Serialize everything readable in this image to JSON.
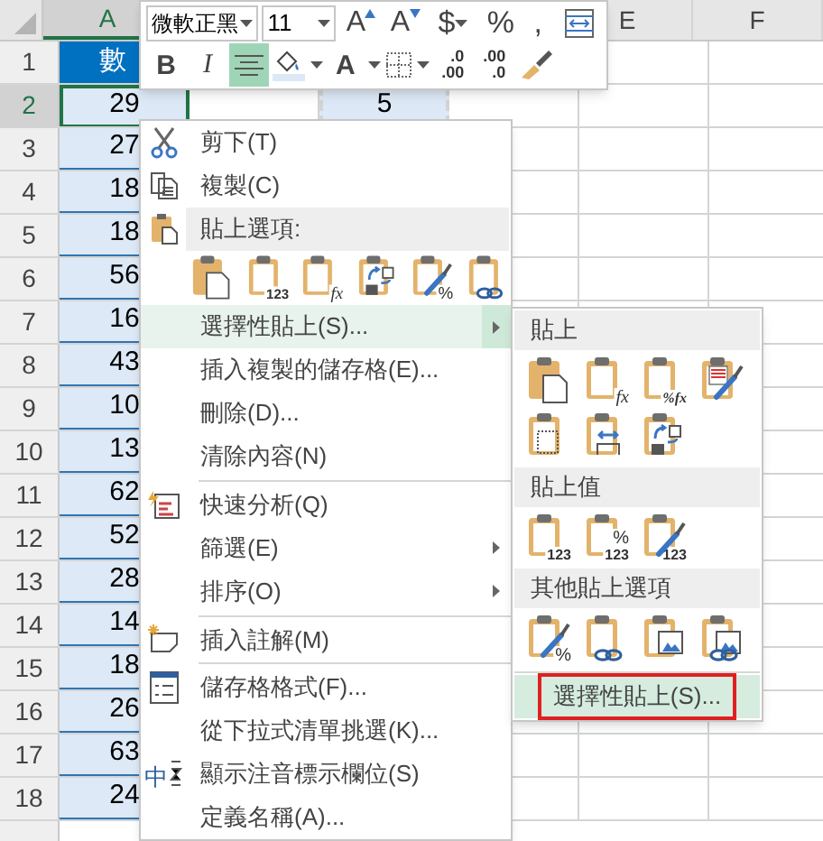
{
  "sheet": {
    "columns": [
      {
        "label": "A",
        "selected": true
      },
      {
        "label": "E",
        "selected": false
      },
      {
        "label": "F",
        "selected": false
      }
    ],
    "rows": [
      {
        "label": "1",
        "selected": false,
        "kind": "header",
        "a": "數"
      },
      {
        "label": "2",
        "selected": true,
        "kind": "data",
        "a": "29",
        "c": "5"
      },
      {
        "label": "3",
        "selected": false,
        "kind": "data",
        "a": "27"
      },
      {
        "label": "4",
        "selected": false,
        "kind": "data",
        "a": "18"
      },
      {
        "label": "5",
        "selected": false,
        "kind": "data",
        "a": "18"
      },
      {
        "label": "6",
        "selected": false,
        "kind": "data",
        "a": "56"
      },
      {
        "label": "7",
        "selected": false,
        "kind": "data",
        "a": "16"
      },
      {
        "label": "8",
        "selected": false,
        "kind": "data",
        "a": "43"
      },
      {
        "label": "9",
        "selected": false,
        "kind": "data",
        "a": "10"
      },
      {
        "label": "10",
        "selected": false,
        "kind": "data",
        "a": "13"
      },
      {
        "label": "11",
        "selected": false,
        "kind": "data",
        "a": "62"
      },
      {
        "label": "12",
        "selected": false,
        "kind": "data",
        "a": "52"
      },
      {
        "label": "13",
        "selected": false,
        "kind": "data",
        "a": "28"
      },
      {
        "label": "14",
        "selected": false,
        "kind": "data",
        "a": "14"
      },
      {
        "label": "15",
        "selected": false,
        "kind": "data",
        "a": "18"
      },
      {
        "label": "16",
        "selected": false,
        "kind": "data",
        "a": "26"
      },
      {
        "label": "17",
        "selected": false,
        "kind": "data",
        "a": "63"
      },
      {
        "label": "18",
        "selected": false,
        "kind": "data",
        "a": "24"
      }
    ]
  },
  "mini_toolbar": {
    "font": "微軟正黑",
    "size": "11",
    "row_1": [
      {
        "kind": "grow-font",
        "glyph": "A",
        "dropdown": false
      },
      {
        "kind": "shrink-font",
        "glyph": "A",
        "dropdown": false
      },
      {
        "kind": "currency",
        "glyph": "$",
        "dropdown": true
      },
      {
        "kind": "percent",
        "glyph": "%",
        "dropdown": false
      },
      {
        "kind": "comma",
        "glyph": ",",
        "dropdown": false
      },
      {
        "kind": "format-table",
        "dropdown": false
      }
    ],
    "row_2": [
      {
        "kind": "bold",
        "glyph": "B",
        "selected": false,
        "dropdown": false
      },
      {
        "kind": "italic",
        "glyph": "I",
        "selected": false,
        "dropdown": false
      },
      {
        "kind": "align-center",
        "selected": true,
        "dropdown": false
      },
      {
        "kind": "fill-color",
        "selected": false,
        "dropdown": true
      },
      {
        "kind": "font-color",
        "glyph": "A",
        "selected": false,
        "dropdown": true
      },
      {
        "kind": "borders",
        "selected": false,
        "dropdown": true
      },
      {
        "kind": "decimal-increase",
        "lines": [
          ".0",
          ".00"
        ],
        "selected": false,
        "dropdown": false
      },
      {
        "kind": "decimal-decrease",
        "lines": [
          ".00",
          ".0"
        ],
        "selected": false,
        "dropdown": false
      },
      {
        "kind": "format-painter",
        "selected": false,
        "dropdown": false
      }
    ]
  },
  "context_menu": {
    "items": [
      {
        "kind": "item",
        "label": "剪下(T)",
        "selected": false,
        "submenu": false
      },
      {
        "kind": "item",
        "label": "複製(C)",
        "selected": false,
        "submenu": false
      },
      {
        "kind": "heading",
        "label": "貼上選項:"
      },
      {
        "kind": "paste-icons",
        "icons": [
          {
            "kind": "page"
          },
          {
            "kind": "glyph",
            "glyphs": [
              "123"
            ]
          },
          {
            "kind": "glyph",
            "glyphs": [
              "fx"
            ]
          },
          {
            "kind": "transpose"
          },
          {
            "kind": "glyph",
            "glyphs": [
              "%"
            ],
            "brush": true
          },
          {
            "kind": "link"
          }
        ]
      },
      {
        "kind": "item",
        "label": "選擇性貼上(S)...",
        "selected": true,
        "submenu": true
      },
      {
        "kind": "item",
        "label": "插入複製的儲存格(E)...",
        "selected": false,
        "submenu": false
      },
      {
        "kind": "item",
        "label": "刪除(D)...",
        "selected": false,
        "submenu": false
      },
      {
        "kind": "item",
        "label": "清除內容(N)",
        "selected": false,
        "submenu": false
      },
      {
        "kind": "separator"
      },
      {
        "kind": "item",
        "label": "快速分析(Q)",
        "selected": false,
        "submenu": false
      },
      {
        "kind": "item",
        "label": "篩選(E)",
        "selected": false,
        "submenu": true
      },
      {
        "kind": "item",
        "label": "排序(O)",
        "selected": false,
        "submenu": true
      },
      {
        "kind": "separator"
      },
      {
        "kind": "item",
        "label": "插入註解(M)",
        "selected": false,
        "submenu": false
      },
      {
        "kind": "separator"
      },
      {
        "kind": "item",
        "label": "儲存格格式(F)...",
        "selected": false,
        "submenu": false
      },
      {
        "kind": "item",
        "label": "從下拉式清單挑選(K)...",
        "selected": false,
        "submenu": false
      },
      {
        "kind": "item",
        "label": "顯示注音標示欄位(S)",
        "icon_glyph": "中",
        "selected": false,
        "submenu": false
      },
      {
        "kind": "item",
        "label": "定義名稱(A)...",
        "selected": false,
        "submenu": false
      }
    ]
  },
  "paste_submenu": {
    "sections": [
      {
        "title": "貼上",
        "icons": [
          {
            "kind": "page"
          },
          {
            "kind": "glyph",
            "glyphs": [
              "fx"
            ]
          },
          {
            "kind": "glyph",
            "glyphs": [
              "%fx"
            ]
          },
          {
            "kind": "page-lines",
            "brush": true
          },
          {
            "kind": "grid"
          },
          {
            "kind": "width"
          },
          {
            "kind": "transpose"
          }
        ]
      },
      {
        "title": "貼上值",
        "icons": [
          {
            "kind": "glyph",
            "glyphs": [
              "123"
            ]
          },
          {
            "kind": "glyph",
            "glyphs": [
              "%",
              "123"
            ]
          },
          {
            "kind": "glyph",
            "glyphs": [
              "123"
            ],
            "brush": true
          }
        ]
      },
      {
        "title": "其他貼上選項",
        "icons": [
          {
            "kind": "glyph",
            "glyphs": [
              "%"
            ],
            "brush": true
          },
          {
            "kind": "link"
          },
          {
            "kind": "picture"
          },
          {
            "kind": "linked-picture"
          }
        ]
      }
    ],
    "footer": {
      "label": "選擇性貼上(S)...",
      "selected": true,
      "outlined": true
    }
  }
}
